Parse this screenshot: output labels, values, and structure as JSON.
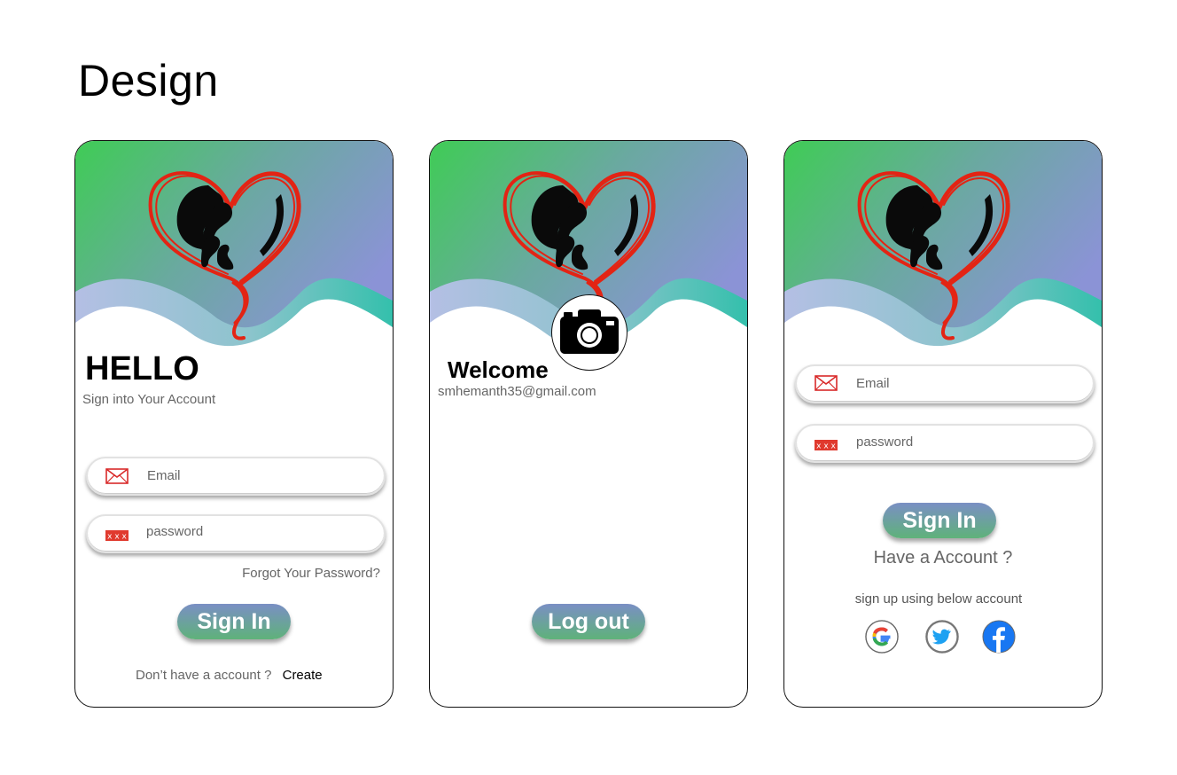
{
  "page": {
    "title": "Design"
  },
  "screen1": {
    "heading": "HELLO",
    "subtitle": "Sign into Your Account",
    "email_placeholder": "Email",
    "password_placeholder": "password",
    "forgot_link": "Forgot Your Password?",
    "signin_label": "Sign In",
    "no_account_text": "Don’t have a account ?",
    "create_link": "Create"
  },
  "screen2": {
    "heading": "Welcome",
    "email": "smhemanth35@gmail.com",
    "logout_label": "Log out"
  },
  "screen3": {
    "email_placeholder": "Email",
    "password_placeholder": "password",
    "signin_label": "Sign In",
    "have_account_text": "Have a Account ?",
    "social_text": "sign up using below account",
    "social_icons": [
      "google-icon",
      "twitter-icon",
      "facebook-icon"
    ]
  },
  "colors": {
    "gradient_green": "#3fcc55",
    "gradient_purple": "#8b93d6",
    "wave_teal": "#3fbfae",
    "heart_red": "#e32414",
    "button_top": "#7a8fc4",
    "button_bottom": "#5fb27a"
  }
}
